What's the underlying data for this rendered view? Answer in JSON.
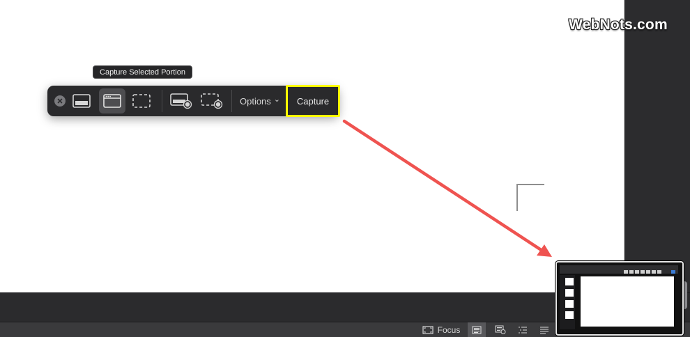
{
  "watermark": "WebNots.com",
  "tooltip": "Capture Selected Portion",
  "toolbar": {
    "close_icon": "close-icon",
    "capture_entire_screen_icon": "screen-icon",
    "capture_window_icon": "window-icon",
    "capture_portion_icon": "dashed-rect-icon",
    "record_screen_icon": "record-screen-icon",
    "record_portion_icon": "record-portion-icon",
    "options_label": "Options",
    "options_chevron": "⌄",
    "capture_label": "Capture",
    "selected_tool": "capture_window",
    "capture_highlight_color": "#ffff00"
  },
  "status_bar": {
    "focus_label": "Focus",
    "focus_icon": "focus-icon",
    "views": [
      {
        "icon": "print-layout-icon",
        "active": true
      },
      {
        "icon": "web-layout-icon",
        "active": false
      },
      {
        "icon": "outline-icon",
        "active": false
      },
      {
        "icon": "draft-icon",
        "active": false
      }
    ]
  },
  "annotation": {
    "arrow_color": "#ef5350"
  }
}
